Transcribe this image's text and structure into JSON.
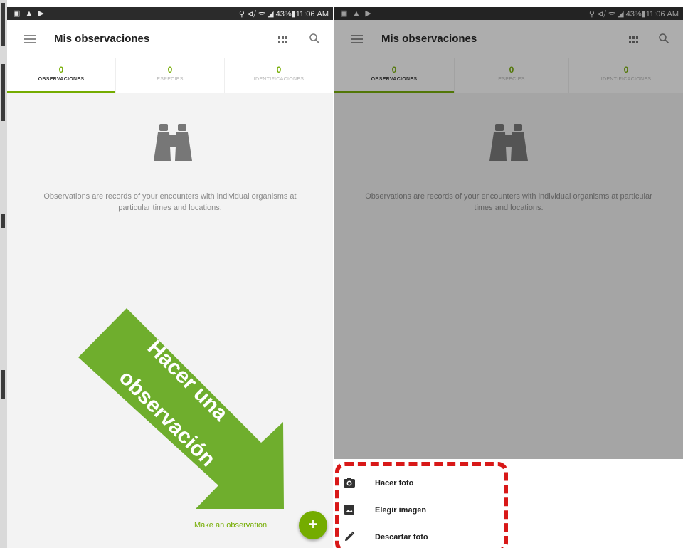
{
  "app": {
    "title": "Mis observaciones"
  },
  "statusbar": {
    "left_icons": "▣ ▲ ▶",
    "right_text_left": "⚲ ⊲⧸ ᯤ ◢ 43%▮11:06 AM",
    "right_text_right": "⚲ ⊲⧸ ᯤ ◢ 43%▮11:06 AM"
  },
  "tabs": [
    {
      "count": "0",
      "label": "OBSERVACIONES"
    },
    {
      "count": "0",
      "label": "ESPECIES"
    },
    {
      "count": "0",
      "label": "IDENTIFICACIONES"
    }
  ],
  "empty_state": {
    "icon": "binoculars-icon",
    "text": "Observations are records of your encounters with individual organisms at particular times and locations."
  },
  "annotation": {
    "line1": "Hacer una",
    "line2": "observación",
    "arrow_color": "#6fae2d",
    "highlight_color": "#d81818"
  },
  "fab": {
    "label": "Make an observation",
    "symbol": "+"
  },
  "sheet": {
    "items": [
      {
        "icon": "camera-icon",
        "label": "Hacer foto"
      },
      {
        "icon": "image-icon",
        "label": "Elegir imagen"
      },
      {
        "icon": "pencil-icon",
        "label": "Descartar foto"
      }
    ]
  },
  "colors": {
    "accent": "#74ac00",
    "statusbar": "#2b2b2b",
    "background": "#f3f3f3"
  }
}
